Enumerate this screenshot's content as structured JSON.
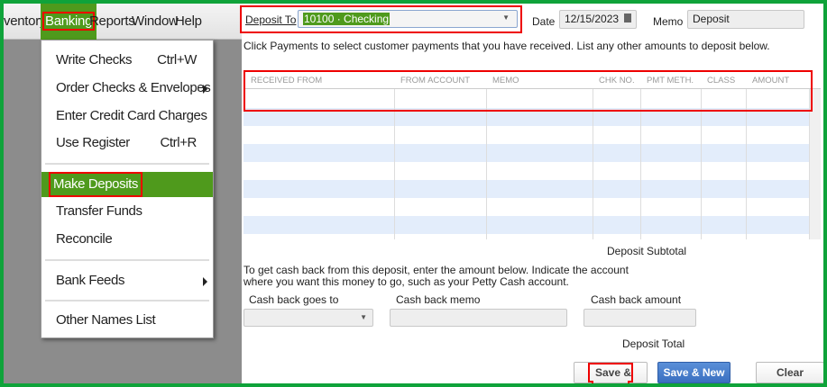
{
  "menubar": {
    "items": [
      "ventory",
      "Banking",
      "Reports",
      "Window",
      "Help"
    ]
  },
  "banking_menu": {
    "items": [
      {
        "label": "Write Checks",
        "shortcut": "Ctrl+W"
      },
      {
        "label": "Order Checks & Envelopes",
        "submenu": true
      },
      {
        "label": "Enter Credit Card Charges"
      },
      {
        "label": "Use Register",
        "shortcut": "Ctrl+R"
      },
      {
        "label": "Make Deposits",
        "selected": true
      },
      {
        "label": "Transfer Funds"
      },
      {
        "label": "Reconcile"
      },
      {
        "label": "Bank Feeds",
        "submenu": true
      },
      {
        "label": "Other Names List"
      }
    ]
  },
  "form": {
    "deposit_to_label": "Deposit To",
    "deposit_to_value": "10100 · Checking",
    "date_label": "Date",
    "date_value": "12/15/2023",
    "memo_label": "Memo",
    "memo_value": "Deposit",
    "instructions": "Click Payments to select customer payments that you have received. List any other amounts to deposit below.",
    "columns": [
      "RECEIVED FROM",
      "FROM ACCOUNT",
      "MEMO",
      "CHK NO.",
      "PMT METH.",
      "CLASS",
      "AMOUNT"
    ],
    "subtotal_label": "Deposit Subtotal",
    "cashback_text_1": "To get cash back from this deposit, enter the amount below.  Indicate the account",
    "cashback_text_2": "where you want this money to go, such as your Petty Cash account.",
    "cashback_goes_to_label": "Cash back goes to",
    "cashback_memo_label": "Cash back memo",
    "cashback_amount_label": "Cash back amount",
    "total_label": "Deposit Total",
    "buttons": {
      "save_close": "Save & Close",
      "save_new": "Save & New",
      "clear": "Clear"
    }
  },
  "colors": {
    "accent_green": "#4f9a1c",
    "frame_green": "#0fa33a",
    "highlight": "#e00000",
    "row_alt": "#e3edfb"
  }
}
